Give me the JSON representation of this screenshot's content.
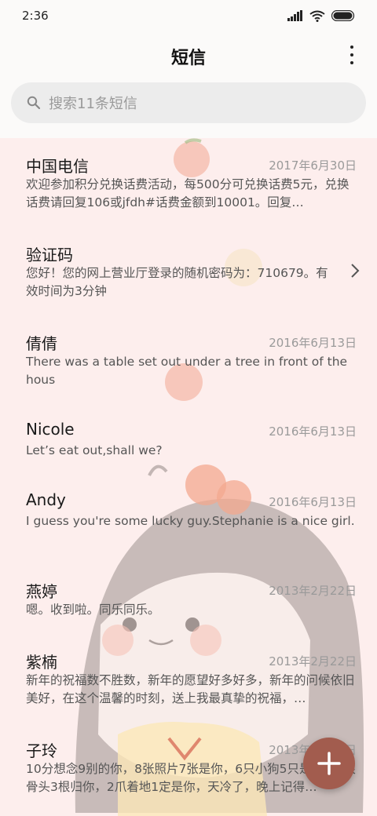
{
  "status_bar": {
    "time": "2:36"
  },
  "header": {
    "title": "短信",
    "search_placeholder": "搜索11条短信"
  },
  "conversations": [
    {
      "name": "中国电信",
      "date": "2017年6月30日",
      "preview": "欢迎参加积分兑换话费活动，每500分可兑换话费5元，兑换话费请回复106或jfdh#话费金额到10001。回复…"
    },
    {
      "name": "验证码",
      "date": "",
      "preview": "您好！您的网上营业厅登录的随机密码为：710679。有效时间为3分钟"
    },
    {
      "name": "倩倩",
      "date": "2016年6月13日",
      "preview": "There was a table set out under a tree in front of the hous"
    },
    {
      "name": "Nicole",
      "date": "2016年6月13日",
      "preview": "Let’s eat out,shall we?"
    },
    {
      "name": "Andy",
      "date": "2016年6月13日",
      "preview": "I guess you're some lucky guy.Stephanie is a nice girl."
    },
    {
      "name": "燕婷",
      "date": "2013年2月22日",
      "preview": "嗯。收到啦。同乐同乐。"
    },
    {
      "name": "紫楠",
      "date": "2013年2月22日",
      "preview": "新年的祝福数不胜数，新年的愿望好多好多，新年的问候依旧美好，在这个温馨的时刻，送上我最真挚的祝福，…"
    },
    {
      "name": "子玲",
      "date": "2013年2月22日",
      "preview": "10分想念9别的你，8张照片7张是你，6只小狗5只是你，4根骨头3根归你，2爪着地1定是你，天冷了，晚上记得…"
    }
  ],
  "colors": {
    "background": "#fdeeed",
    "fab": "#a25c4e"
  }
}
